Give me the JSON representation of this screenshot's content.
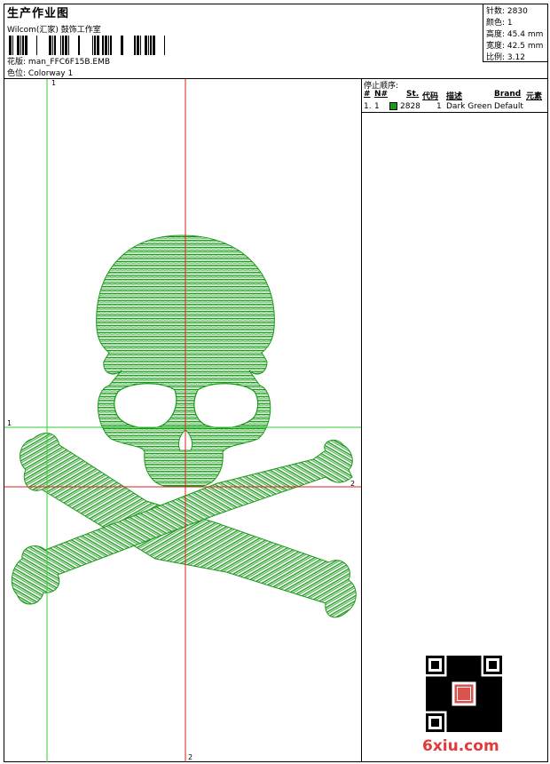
{
  "header": {
    "title": "生产作业图",
    "company": "Wilcom(汇家) 鼓饰工作室",
    "design_label": "花版:",
    "design_value": "man_FFC6F15B.EMB",
    "colorway_label": "色位:",
    "colorway_value": "Colorway 1"
  },
  "stats": [
    {
      "label": "针数:",
      "value": "2830"
    },
    {
      "label": "颜色:",
      "value": "1"
    },
    {
      "label": "高度:",
      "value": "45.4 mm"
    },
    {
      "label": "宽度:",
      "value": "42.5 mm"
    },
    {
      "label": "比例:",
      "value": "3.12"
    }
  ],
  "stop_sequence": {
    "caption": "停止顺序:",
    "headers": {
      "num": "#",
      "n": "N#",
      "st": "St.",
      "code": "代码",
      "desc": "描述",
      "brand": "Brand",
      "elem": "元素"
    },
    "rows": [
      {
        "num": "1.",
        "n": "1",
        "color": "#1a9a1a",
        "st": "2828",
        "code": "1",
        "desc": "Dark Green",
        "brand": "Default"
      }
    ]
  },
  "axis_labels": {
    "top": "1",
    "left": "1",
    "right": "2",
    "bottom": "2"
  },
  "watermark": "6xiu.com",
  "colors": {
    "thread": "#1a9a1a",
    "guide_green": "#33cc33",
    "guide_red": "#dd2222"
  }
}
